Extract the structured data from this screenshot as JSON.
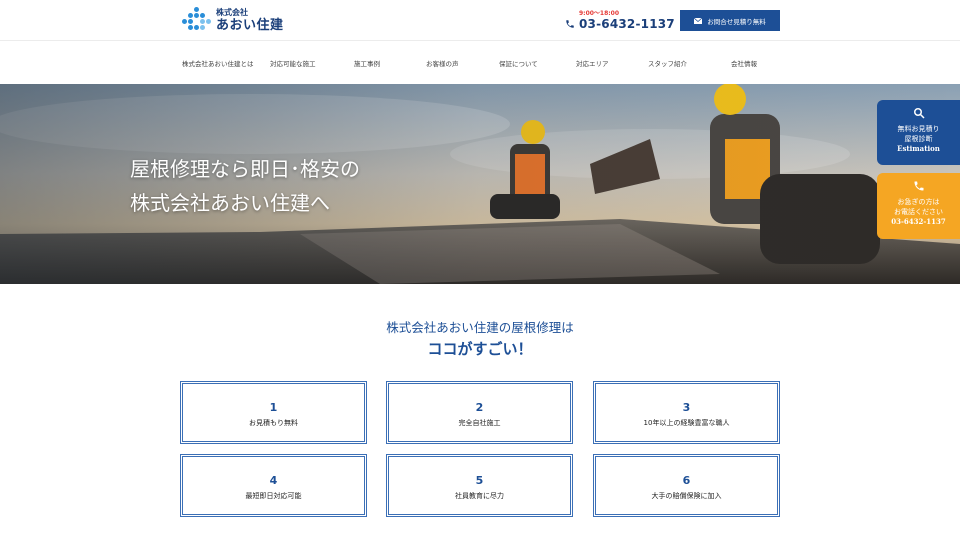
{
  "header": {
    "logo_sub": "株式会社",
    "logo_main": "あおい住建",
    "hours": "9:00～18:00",
    "phone": "03-6432-1137",
    "contact_button": "お問合せ見積り無料"
  },
  "nav": {
    "items": [
      "株式会社あおい住建とは",
      "対応可能な施工",
      "施工事例",
      "お客様の声",
      "保証について",
      "対応エリア",
      "スタッフ紹介",
      "会社情報"
    ]
  },
  "hero": {
    "line1": "屋根修理なら即日･格安の",
    "line2": "株式会社あおい住建へ"
  },
  "side": {
    "estimate_line1": "無料お見積り",
    "estimate_line2": "屋根診断",
    "estimate_line3": "Estimation",
    "call_line1": "お急ぎの方は",
    "call_line2": "お電話ください",
    "call_line3": "03-6432-1137"
  },
  "section": {
    "title_line1": "株式会社あおい住建の屋根修理は",
    "title_line2": "ココがすごい！",
    "cards": [
      {
        "num": "1",
        "label": "お見積もり無料"
      },
      {
        "num": "2",
        "label": "完全自社施工"
      },
      {
        "num": "3",
        "label": "10年以上の経験豊富な職人"
      },
      {
        "num": "4",
        "label": "最短即日対応可能"
      },
      {
        "num": "5",
        "label": "社員教育に尽力"
      },
      {
        "num": "6",
        "label": "大手の賠償保険に加入"
      }
    ]
  },
  "colors": {
    "brand_blue": "#1d4f96",
    "accent_orange": "#f5a623",
    "hours_red": "#e53935"
  }
}
